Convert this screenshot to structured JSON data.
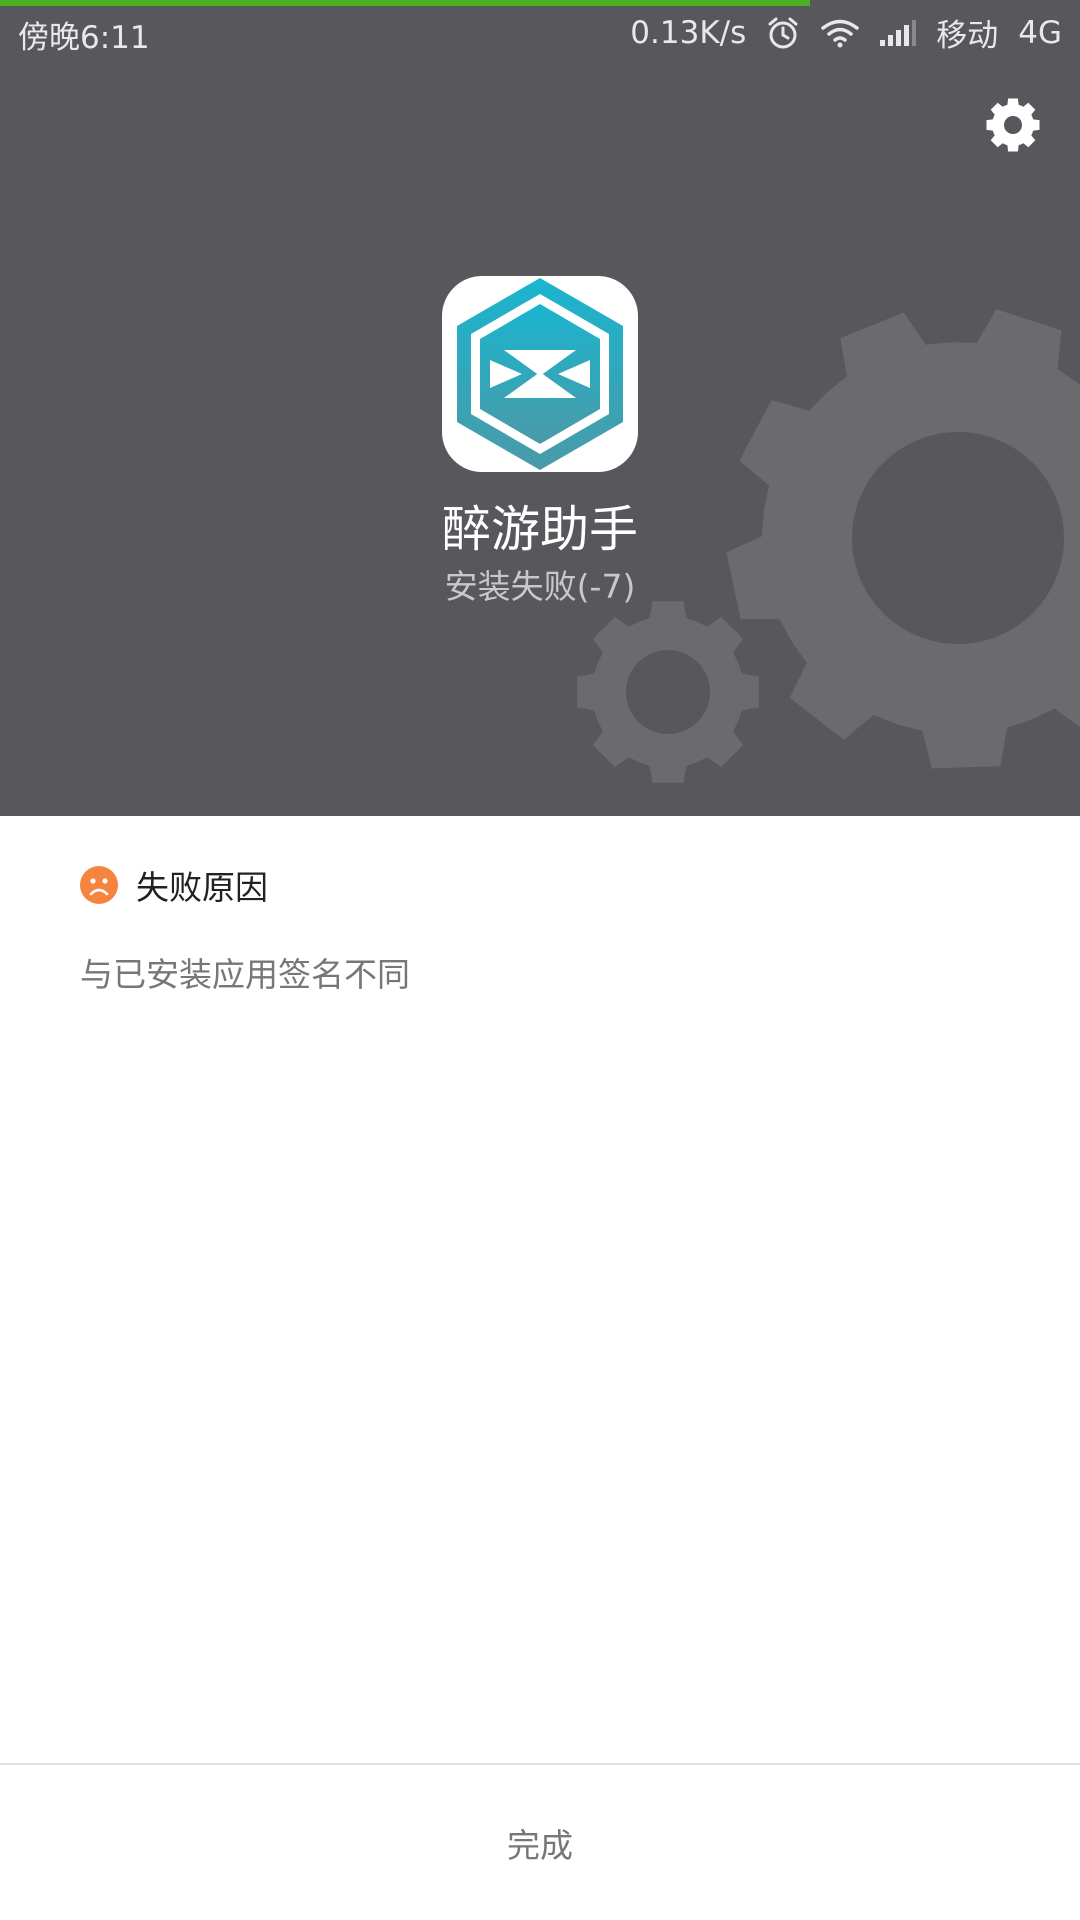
{
  "status_bar": {
    "time": "傍晚6:11",
    "network_speed": "0.13K/s",
    "carrier": "移动",
    "network_type": "4G",
    "icons": [
      "alarm-icon",
      "wifi-icon",
      "signal-icon"
    ]
  },
  "install_progress": 0.75,
  "header": {
    "settings_icon": "gear-icon",
    "app_name": "醉游助手",
    "status": "安装失败(-7)"
  },
  "failure": {
    "icon": "sad-face-icon",
    "title": "失败原因",
    "reason": "与已安装应用签名不同"
  },
  "footer": {
    "done_label": "完成"
  },
  "colors": {
    "header_bg": "#58575c",
    "gear_decoration": "#6b6b6e",
    "progress": "#4caf20",
    "sad_face": "#f5843f",
    "icon_teal": "#1aaec8"
  }
}
